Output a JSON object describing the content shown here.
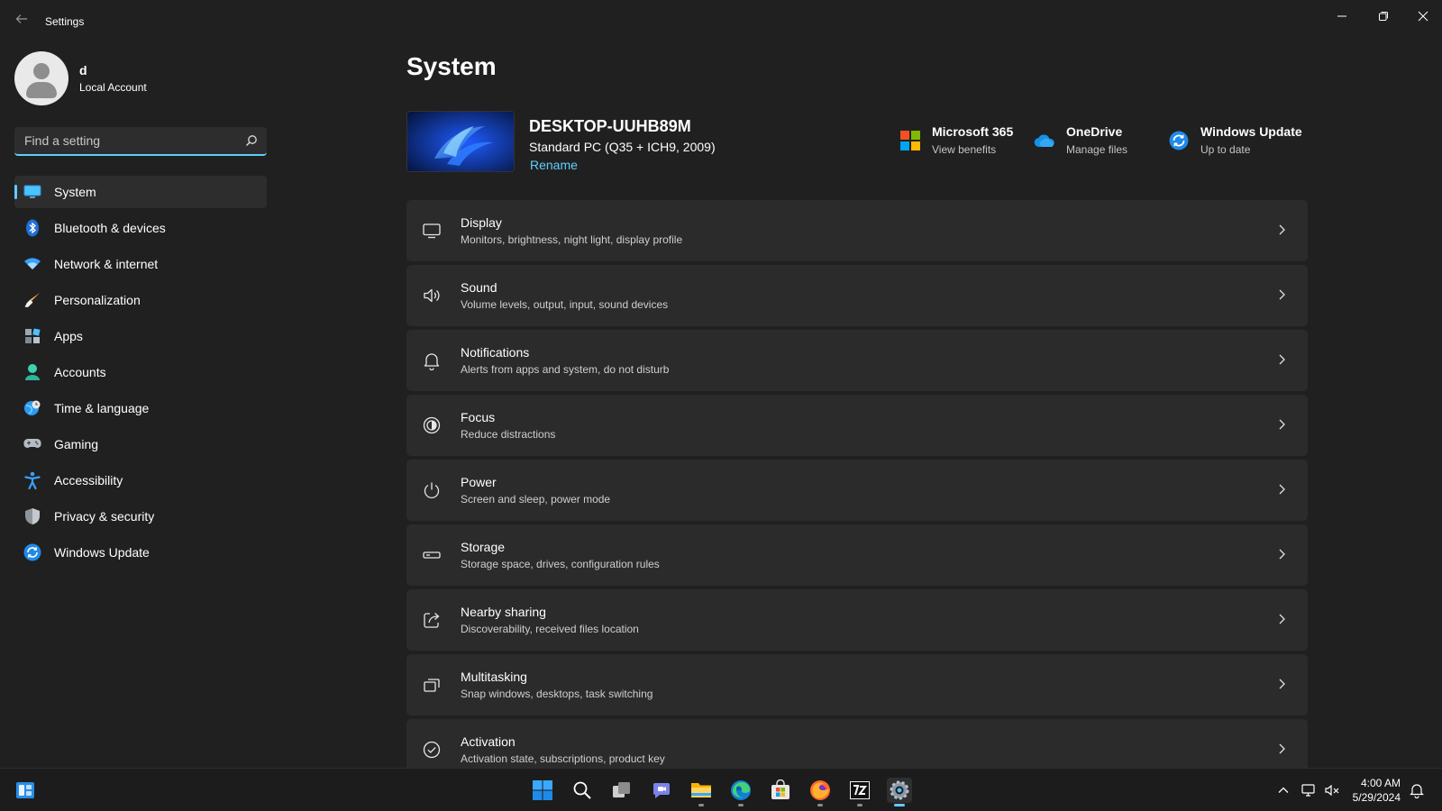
{
  "window": {
    "app_title": "Settings",
    "back_icon": "back-arrow-icon",
    "controls": [
      "minimize-icon",
      "restore-icon",
      "close-icon"
    ]
  },
  "profile": {
    "name": "d",
    "account_type": "Local Account"
  },
  "search": {
    "placeholder": "Find a setting"
  },
  "sidebar": {
    "items": [
      {
        "label": "System",
        "icon": "system-monitor-icon",
        "active": true
      },
      {
        "label": "Bluetooth & devices",
        "icon": "bluetooth-icon"
      },
      {
        "label": "Network & internet",
        "icon": "wifi-icon"
      },
      {
        "label": "Personalization",
        "icon": "brush-icon"
      },
      {
        "label": "Apps",
        "icon": "apps-icon"
      },
      {
        "label": "Accounts",
        "icon": "accounts-icon"
      },
      {
        "label": "Time & language",
        "icon": "globe-clock-icon"
      },
      {
        "label": "Gaming",
        "icon": "gamepad-icon"
      },
      {
        "label": "Accessibility",
        "icon": "accessibility-icon"
      },
      {
        "label": "Privacy & security",
        "icon": "shield-icon"
      },
      {
        "label": "Windows Update",
        "icon": "windows-update-icon"
      }
    ]
  },
  "main": {
    "title": "System",
    "device": {
      "name": "DESKTOP-UUHB89M",
      "model": "Standard PC (Q35 + ICH9, 2009)",
      "rename_label": "Rename"
    },
    "quick_links": [
      {
        "title": "Microsoft 365",
        "subtitle": "View benefits",
        "icon": "microsoft-logo-icon"
      },
      {
        "title": "OneDrive",
        "subtitle": "Manage files",
        "icon": "onedrive-cloud-icon"
      },
      {
        "title": "Windows Update",
        "subtitle": "Up to date",
        "icon": "windows-update-icon"
      }
    ],
    "cards": [
      {
        "title": "Display",
        "subtitle": "Monitors, brightness, night light, display profile",
        "icon": "display-icon"
      },
      {
        "title": "Sound",
        "subtitle": "Volume levels, output, input, sound devices",
        "icon": "speaker-icon"
      },
      {
        "title": "Notifications",
        "subtitle": "Alerts from apps and system, do not disturb",
        "icon": "bell-icon"
      },
      {
        "title": "Focus",
        "subtitle": "Reduce distractions",
        "icon": "focus-icon"
      },
      {
        "title": "Power",
        "subtitle": "Screen and sleep, power mode",
        "icon": "power-icon"
      },
      {
        "title": "Storage",
        "subtitle": "Storage space, drives, configuration rules",
        "icon": "storage-drive-icon"
      },
      {
        "title": "Nearby sharing",
        "subtitle": "Discoverability, received files location",
        "icon": "share-icon"
      },
      {
        "title": "Multitasking",
        "subtitle": "Snap windows, desktops, task switching",
        "icon": "multitasking-icon"
      },
      {
        "title": "Activation",
        "subtitle": "Activation state, subscriptions, product key",
        "icon": "activation-check-icon"
      }
    ]
  },
  "taskbar": {
    "time": "4:00 AM",
    "date": "5/29/2024",
    "apps": [
      "start-icon",
      "search-icon",
      "task-view-icon",
      "chat-icon",
      "file-explorer-icon",
      "edge-icon",
      "store-icon",
      "firefox-icon",
      "7zip-icon",
      "settings-gear-icon"
    ]
  },
  "colors": {
    "accent": "#60cdff",
    "background": "#202020",
    "card": "#2b2b2b"
  }
}
